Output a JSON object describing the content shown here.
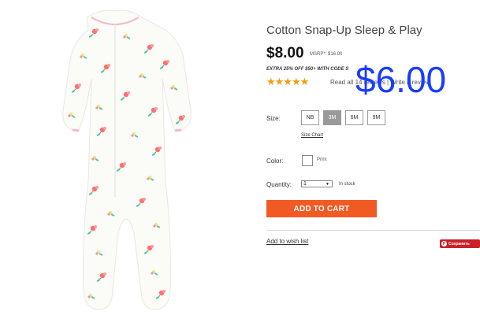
{
  "product": {
    "title": "Cotton Snap-Up Sleep & Play",
    "price": "$8.00",
    "msrp": "MSRP*: $16.00",
    "promo": "EXTRA 25% OFF $50+ WITH CODE S",
    "rating_stars": "★★★★★",
    "reviews": "Read all 14 reviews | Write a review",
    "overlay_price": "$6.00",
    "image_icon": "floral-footed-sleeper-image"
  },
  "size": {
    "label": "Size:",
    "options": [
      "NB",
      "3M",
      "6M",
      "9M"
    ],
    "selected": "3M",
    "chart_link": "Size Chart"
  },
  "color": {
    "label": "Color:",
    "value": "Print"
  },
  "quantity": {
    "label": "Quantity:",
    "value": "1",
    "caret": "▼",
    "stock": "In stock"
  },
  "actions": {
    "add_to_cart": "ADD TO CART",
    "wishlist": "Add to wish list",
    "pin_logo": "P",
    "pin_label": "Сохранить"
  },
  "colors": {
    "accent": "#f15a22",
    "overlay": "#1a3cff",
    "stars": "#f39c12",
    "pinterest": "#cb2027"
  }
}
